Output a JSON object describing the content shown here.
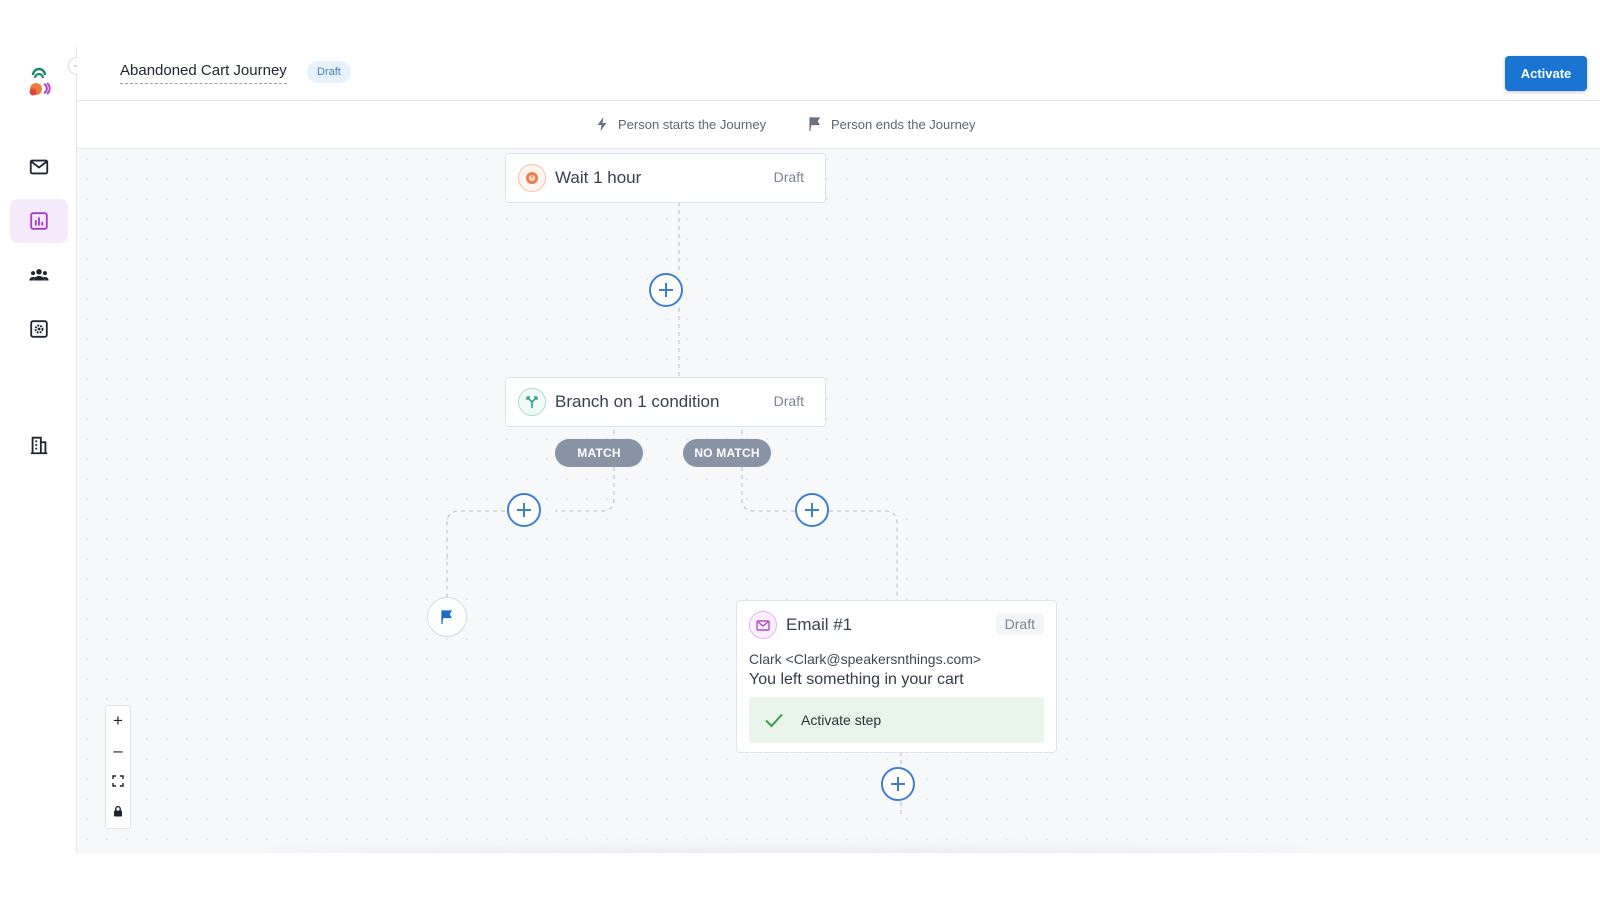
{
  "app": {
    "title": "Abandoned Cart Journey",
    "status_badge": "Draft",
    "activate_label": "Activate"
  },
  "sidebar": {
    "items": [
      {
        "name": "messages",
        "icon": "mail-icon",
        "active": false
      },
      {
        "name": "analytics",
        "icon": "bar-chart-icon",
        "active": true
      },
      {
        "name": "people",
        "icon": "people-icon",
        "active": false
      },
      {
        "name": "settings",
        "icon": "settings-icon",
        "active": false
      },
      {
        "name": "workspace",
        "icon": "building-icon",
        "active": false
      }
    ]
  },
  "subbar": {
    "start_label": "Person starts the Journey",
    "end_label": "Person ends the Journey"
  },
  "nodes": {
    "wait": {
      "title": "Wait 1 hour",
      "status": "Draft",
      "icon": "clock-icon"
    },
    "branch": {
      "title": "Branch on 1 condition",
      "status": "Draft",
      "icon": "branch-icon"
    },
    "email": {
      "title": "Email #1",
      "status": "Draft",
      "icon": "mail-icon",
      "from": "Clark <Clark@speakersnthings.com>",
      "subject": "You left something in your cart",
      "activate_step_label": "Activate step"
    }
  },
  "branch_labels": {
    "match": "MATCH",
    "no_match": "NO MATCH"
  },
  "zoom": {
    "zoom_in": "+",
    "zoom_out": "–"
  },
  "colors": {
    "accent": "#1a75d2",
    "pill": "#8893a6",
    "wait_icon": "#ec7a4b",
    "branch_icon": "#2e9c8a",
    "email_icon": "#b548c6",
    "success": "#3d9a47"
  }
}
